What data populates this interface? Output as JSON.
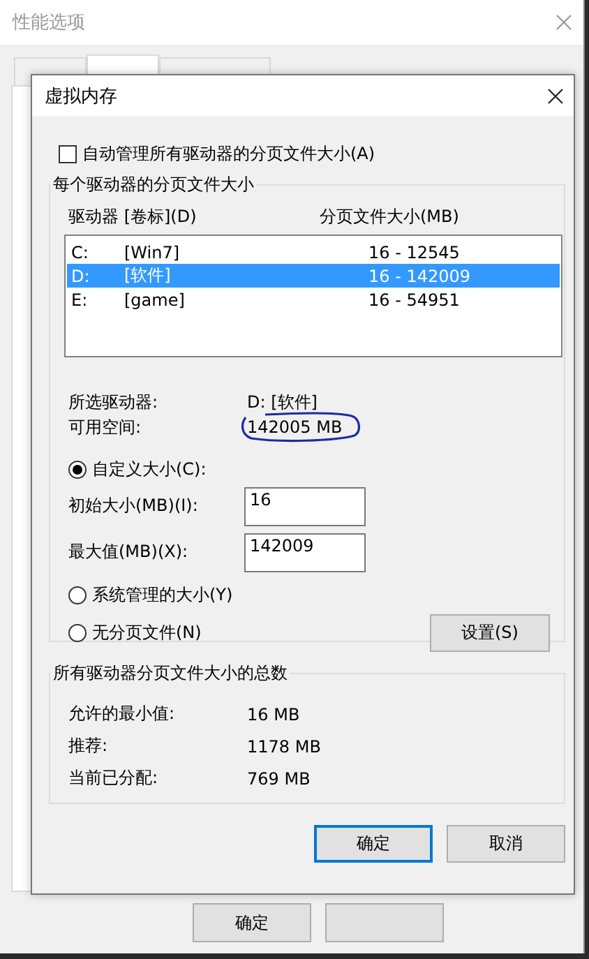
{
  "background_window": {
    "title": "性能选项",
    "tabs": [
      {
        "selected": false
      },
      {
        "selected": true
      },
      {
        "selected": false
      }
    ],
    "buttons": [
      {
        "label": "确定"
      }
    ]
  },
  "dialog": {
    "title": "虚拟内存",
    "auto_manage": {
      "label": "自动管理所有驱动器的分页文件大小(A)",
      "checked": false
    },
    "per_drive": {
      "title": "每个驱动器的分页文件大小",
      "columns": [
        "驱动器 [卷标](D)",
        "分页文件大小(MB)"
      ],
      "drives": [
        {
          "drive": "C:",
          "label": "[Win7]",
          "size": "16 - 12545",
          "selected": false
        },
        {
          "drive": "D:",
          "label": "[软件]",
          "size": "16 - 142009",
          "selected": true
        },
        {
          "drive": "E:",
          "label": "[game]",
          "size": "16 - 54951",
          "selected": false
        }
      ],
      "selected_drive": {
        "label": "所选驱动器:",
        "value": "D:  [软件]"
      },
      "free_space": {
        "label": "可用空间:",
        "value": "142005 MB",
        "circled": true
      },
      "size_options": [
        {
          "label": "自定义大小(C):",
          "selected": true,
          "fields": [
            {
              "label": "初始大小(MB)(I):",
              "value": "16"
            },
            {
              "label": "最大值(MB)(X):",
              "value": "142009"
            }
          ]
        },
        {
          "label": "系统管理的大小(Y)",
          "selected": false
        },
        {
          "label": "无分页文件(N)",
          "selected": false
        }
      ],
      "set_button": "设置(S)"
    },
    "totals": {
      "title": "所有驱动器分页文件大小的总数",
      "rows": [
        {
          "label": "允许的最小值:",
          "value": "16 MB"
        },
        {
          "label": "推荐:",
          "value": "1178 MB"
        },
        {
          "label": "当前已分配:",
          "value": "769 MB"
        }
      ]
    },
    "buttons": [
      {
        "label": "确定",
        "focused": true
      },
      {
        "label": "取消",
        "focused": false
      }
    ]
  }
}
